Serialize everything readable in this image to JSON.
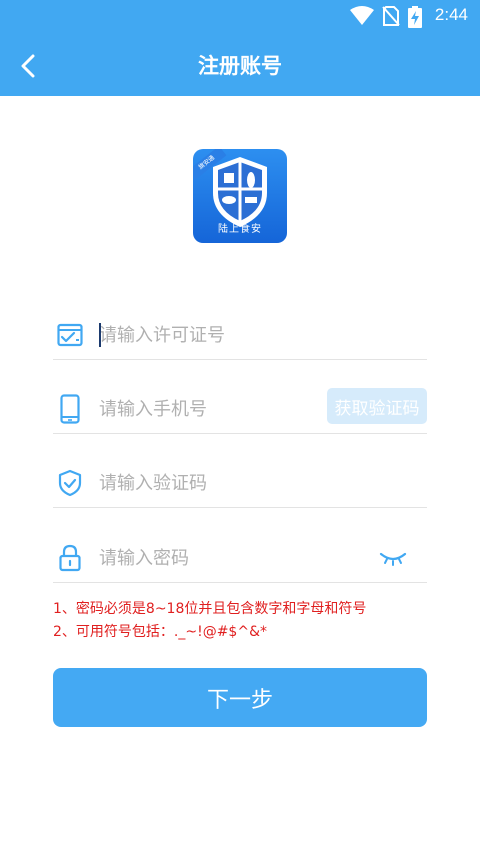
{
  "status_bar": {
    "time": "2:44"
  },
  "header": {
    "title": "注册账号"
  },
  "logo": {
    "ribbon_text": "旗安通",
    "caption": "陆上食安"
  },
  "form": {
    "license_placeholder": "请输入许可证号",
    "phone_placeholder": "请输入手机号",
    "get_code_label": "获取验证码",
    "code_placeholder": "请输入验证码",
    "password_placeholder": "请输入密码"
  },
  "rules": [
    "1、密码必须是8~18位并且包含数字和字母和符号",
    "2、可用符号包括：._~!@#$^&*"
  ],
  "next_button": "下一步",
  "colors": {
    "primary": "#41a8f2",
    "button_disabled": "#d6ebfb",
    "warning_text": "#e02020",
    "icon": "#41a8f2"
  }
}
